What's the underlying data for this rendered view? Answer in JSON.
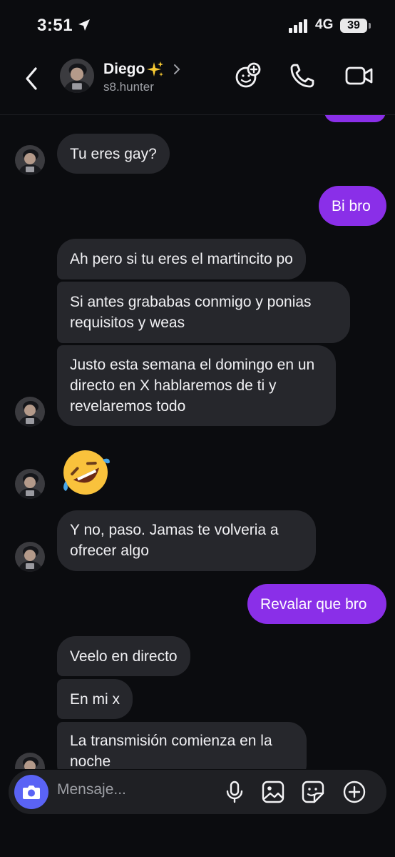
{
  "status_bar": {
    "time": "3:51",
    "network": "4G",
    "battery": "39"
  },
  "header": {
    "name": "Diego",
    "username": "s8.hunter",
    "icons": [
      "back-icon",
      "sparkles-emoji",
      "chevron-right-icon",
      "sticker-chat-icon",
      "phone-icon",
      "video-camera-icon"
    ]
  },
  "messages": [
    {
      "from": "other",
      "text": "Tu eres gay?"
    },
    {
      "from": "me",
      "text": "Bi bro"
    },
    {
      "from": "other",
      "text": "Ah pero si tu eres el martincito po"
    },
    {
      "from": "other",
      "text": "Si antes grababas conmigo y ponias requisitos y weas"
    },
    {
      "from": "other",
      "text": "Justo esta semana el domingo en un directo en X hablaremos de ti y revelaremos todo"
    },
    {
      "from": "other",
      "emoji": "rolling-on-floor-laughing"
    },
    {
      "from": "other",
      "text": "Y no, paso. Jamas te volveria a ofrecer algo"
    },
    {
      "from": "me",
      "text": "Revalar que bro"
    },
    {
      "from": "other",
      "text": "Veelo en directo"
    },
    {
      "from": "other",
      "text": "En mi x"
    },
    {
      "from": "other",
      "text": "La transmisión comienza en la noche"
    }
  ],
  "composer": {
    "placeholder": "Mensaje...",
    "icons": [
      "camera-icon",
      "microphone-icon",
      "gallery-icon",
      "sticker-icon",
      "add-icon"
    ]
  },
  "colors": {
    "background": "#0b0c0f",
    "incoming_bubble": "#26272c",
    "outgoing_bubble": "#8a2fe8",
    "camera_button": "#5a63f5"
  }
}
